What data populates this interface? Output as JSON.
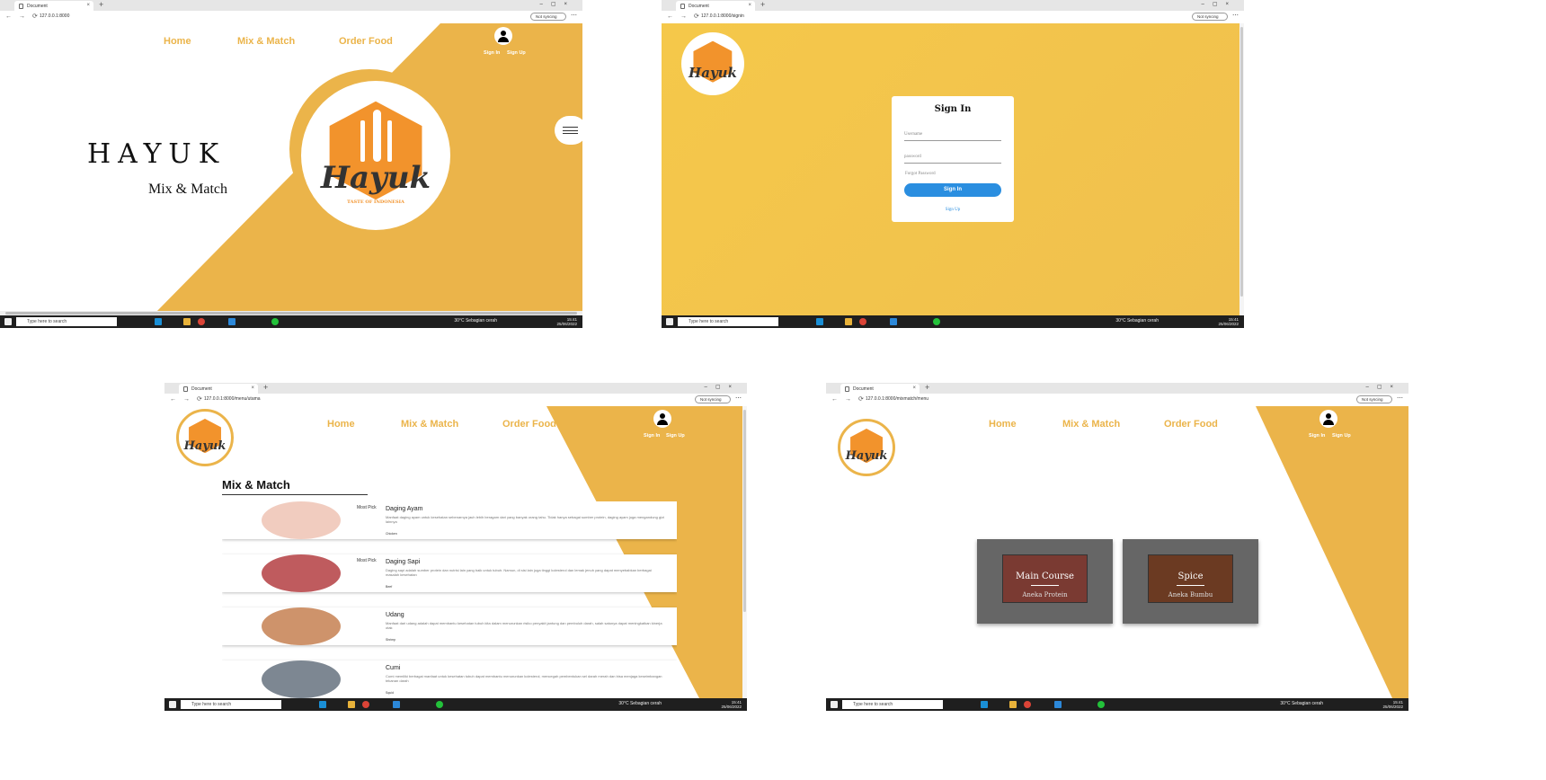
{
  "common": {
    "tab_title": "Document",
    "sync_label": "Not syncing",
    "taskbar_search": "Type here to search",
    "weather": "30°C  Sebagian cerah",
    "time": "15:41",
    "date": "25/06/2022",
    "nav": {
      "home": "Home",
      "mix": "Mix & Match",
      "order": "Order Food"
    },
    "sign_in": "Sign In",
    "sign_up": "Sign Up",
    "logo_word": "Hayuk",
    "logo_tag": "TASTE OF INDONESIA"
  },
  "home": {
    "url": "127.0.0.1:8000",
    "title": "HAYUK",
    "subtitle": "Mix & Match"
  },
  "signin": {
    "url": "127.0.0.1:8000/signin",
    "heading": "Sign In",
    "username_ph": "Username",
    "password_ph": "password",
    "forgot": "Forgot Password",
    "button": "Sign In",
    "signup_link": "Sign Up"
  },
  "menu": {
    "url": "127.0.0.1:8000/menu/utama",
    "heading": "Mix & Match",
    "items": [
      {
        "name": "Daging Ayam",
        "badge": "Most Pick",
        "desc": "Manfaat daging ayam untuk kesehatan sebenarnya jauh lebih beragam dari yang banyak orang tahu. Tidak hanya sebagai sumber protein, daging ayam juga mengandung gizi lainnya",
        "tag": "Chicken",
        "color": "#f0c7b8"
      },
      {
        "name": "Daging Sapi",
        "badge": "Most Pick",
        "desc": "Daging sapi adalah sumber protein dan nutrisi lain yang baik untuk tubuh. Namun, di sisi lain juga tinggi kolesterol dan lemak jenuh yang dapat menyebabkan berbagai masalah kesehatan",
        "tag": "Beef",
        "color": "#b8494d"
      },
      {
        "name": "Udang",
        "badge": "",
        "desc": "Manfaat dari udang adalah dapat membantu kesehatan tubuh kita dalam menurunkan risiko penyakit jantung dan pembuluh darah, salah satunya dapat meningkatkan kinerja otak",
        "tag": "Shrimp",
        "color": "#c9875b"
      },
      {
        "name": "Cumi",
        "badge": "",
        "desc": "Cumi memiliki berbagai manfaat untuk kesehatan tubuh dapat membantu menurunkan kolesterol, mencegah pembentukan sel darah merah dan bisa menjaga keseimbangan tekanan darah",
        "tag": "Squid",
        "color": "#6f7a86"
      }
    ]
  },
  "category": {
    "url": "127.0.0.1:8000/mixmatch/menu",
    "cards": [
      {
        "title": "Main Course",
        "sub": "Aneka Protein",
        "color": "#7a3a32"
      },
      {
        "title": "Spice",
        "sub": "Aneka Bumbu",
        "color": "#6b3a22"
      }
    ]
  }
}
